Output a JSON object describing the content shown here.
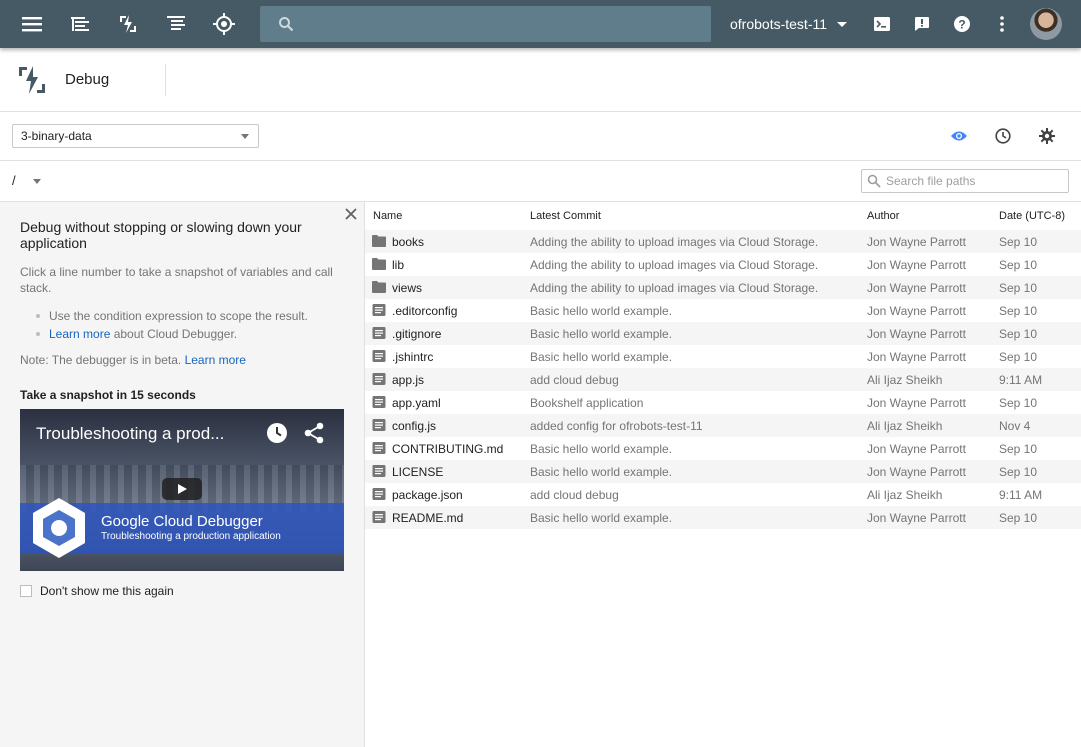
{
  "topbar": {
    "search_placeholder": "",
    "project": "ofrobots-test-11",
    "icons": [
      "menu-icon",
      "stackdriver-logging-icon",
      "debug-icon",
      "trace-icon",
      "monitoring-icon",
      "cloud-shell-icon",
      "feedback-icon",
      "help-icon",
      "more-vert-icon",
      "avatar"
    ]
  },
  "header": {
    "title": "Debug"
  },
  "toolbar": {
    "source_selected": "3-binary-data",
    "icons": [
      "eye-icon",
      "history-icon",
      "settings-icon"
    ],
    "accent": "#4285f4"
  },
  "pathbar": {
    "root": "/",
    "search_placeholder": "Search file paths"
  },
  "left_panel": {
    "title": "Debug without stopping or slowing down your application",
    "intro": "Click a line number to take a snapshot of variables and call stack.",
    "bullet1": "Use the condition expression to scope the result.",
    "bullet2_link": "Learn more",
    "bullet2_rest": " about Cloud Debugger.",
    "note_prefix": "Note: The debugger is in beta. ",
    "note_link": "Learn more",
    "snapshot_title": "Take a snapshot in 15 seconds",
    "video": {
      "title": "Troubleshooting a prod...",
      "brand": "Google Cloud Debugger",
      "subtitle": "Troubleshooting a production application"
    },
    "dont_show": "Don't show me this again"
  },
  "table": {
    "headers": {
      "name": "Name",
      "commit": "Latest Commit",
      "author": "Author",
      "date": "Date (UTC-8)"
    },
    "rows": [
      {
        "type": "folder",
        "name": "books",
        "commit": "Adding the ability to upload images via Cloud Storage.",
        "author": "Jon Wayne Parrott",
        "date": "Sep 10"
      },
      {
        "type": "folder",
        "name": "lib",
        "commit": "Adding the ability to upload images via Cloud Storage.",
        "author": "Jon Wayne Parrott",
        "date": "Sep 10"
      },
      {
        "type": "folder",
        "name": "views",
        "commit": "Adding the ability to upload images via Cloud Storage.",
        "author": "Jon Wayne Parrott",
        "date": "Sep 10"
      },
      {
        "type": "file",
        "name": ".editorconfig",
        "commit": "Basic hello world example.",
        "author": "Jon Wayne Parrott",
        "date": "Sep 10"
      },
      {
        "type": "file",
        "name": ".gitignore",
        "commit": "Basic hello world example.",
        "author": "Jon Wayne Parrott",
        "date": "Sep 10"
      },
      {
        "type": "file",
        "name": ".jshintrc",
        "commit": "Basic hello world example.",
        "author": "Jon Wayne Parrott",
        "date": "Sep 10"
      },
      {
        "type": "file",
        "name": "app.js",
        "commit": "add cloud debug",
        "author": "Ali Ijaz Sheikh",
        "date": "9:11 AM"
      },
      {
        "type": "file",
        "name": "app.yaml",
        "commit": "Bookshelf application",
        "author": "Jon Wayne Parrott",
        "date": "Sep 10"
      },
      {
        "type": "file",
        "name": "config.js",
        "commit": "added config for ofrobots-test-11",
        "author": "Ali Ijaz Sheikh",
        "date": "Nov 4"
      },
      {
        "type": "file",
        "name": "CONTRIBUTING.md",
        "commit": "Basic hello world example.",
        "author": "Jon Wayne Parrott",
        "date": "Sep 10"
      },
      {
        "type": "file",
        "name": "LICENSE",
        "commit": "Basic hello world example.",
        "author": "Jon Wayne Parrott",
        "date": "Sep 10"
      },
      {
        "type": "file",
        "name": "package.json",
        "commit": "add cloud debug",
        "author": "Ali Ijaz Sheikh",
        "date": "9:11 AM"
      },
      {
        "type": "file",
        "name": "README.md",
        "commit": "Basic hello world example.",
        "author": "Jon Wayne Parrott",
        "date": "Sep 10"
      }
    ]
  }
}
